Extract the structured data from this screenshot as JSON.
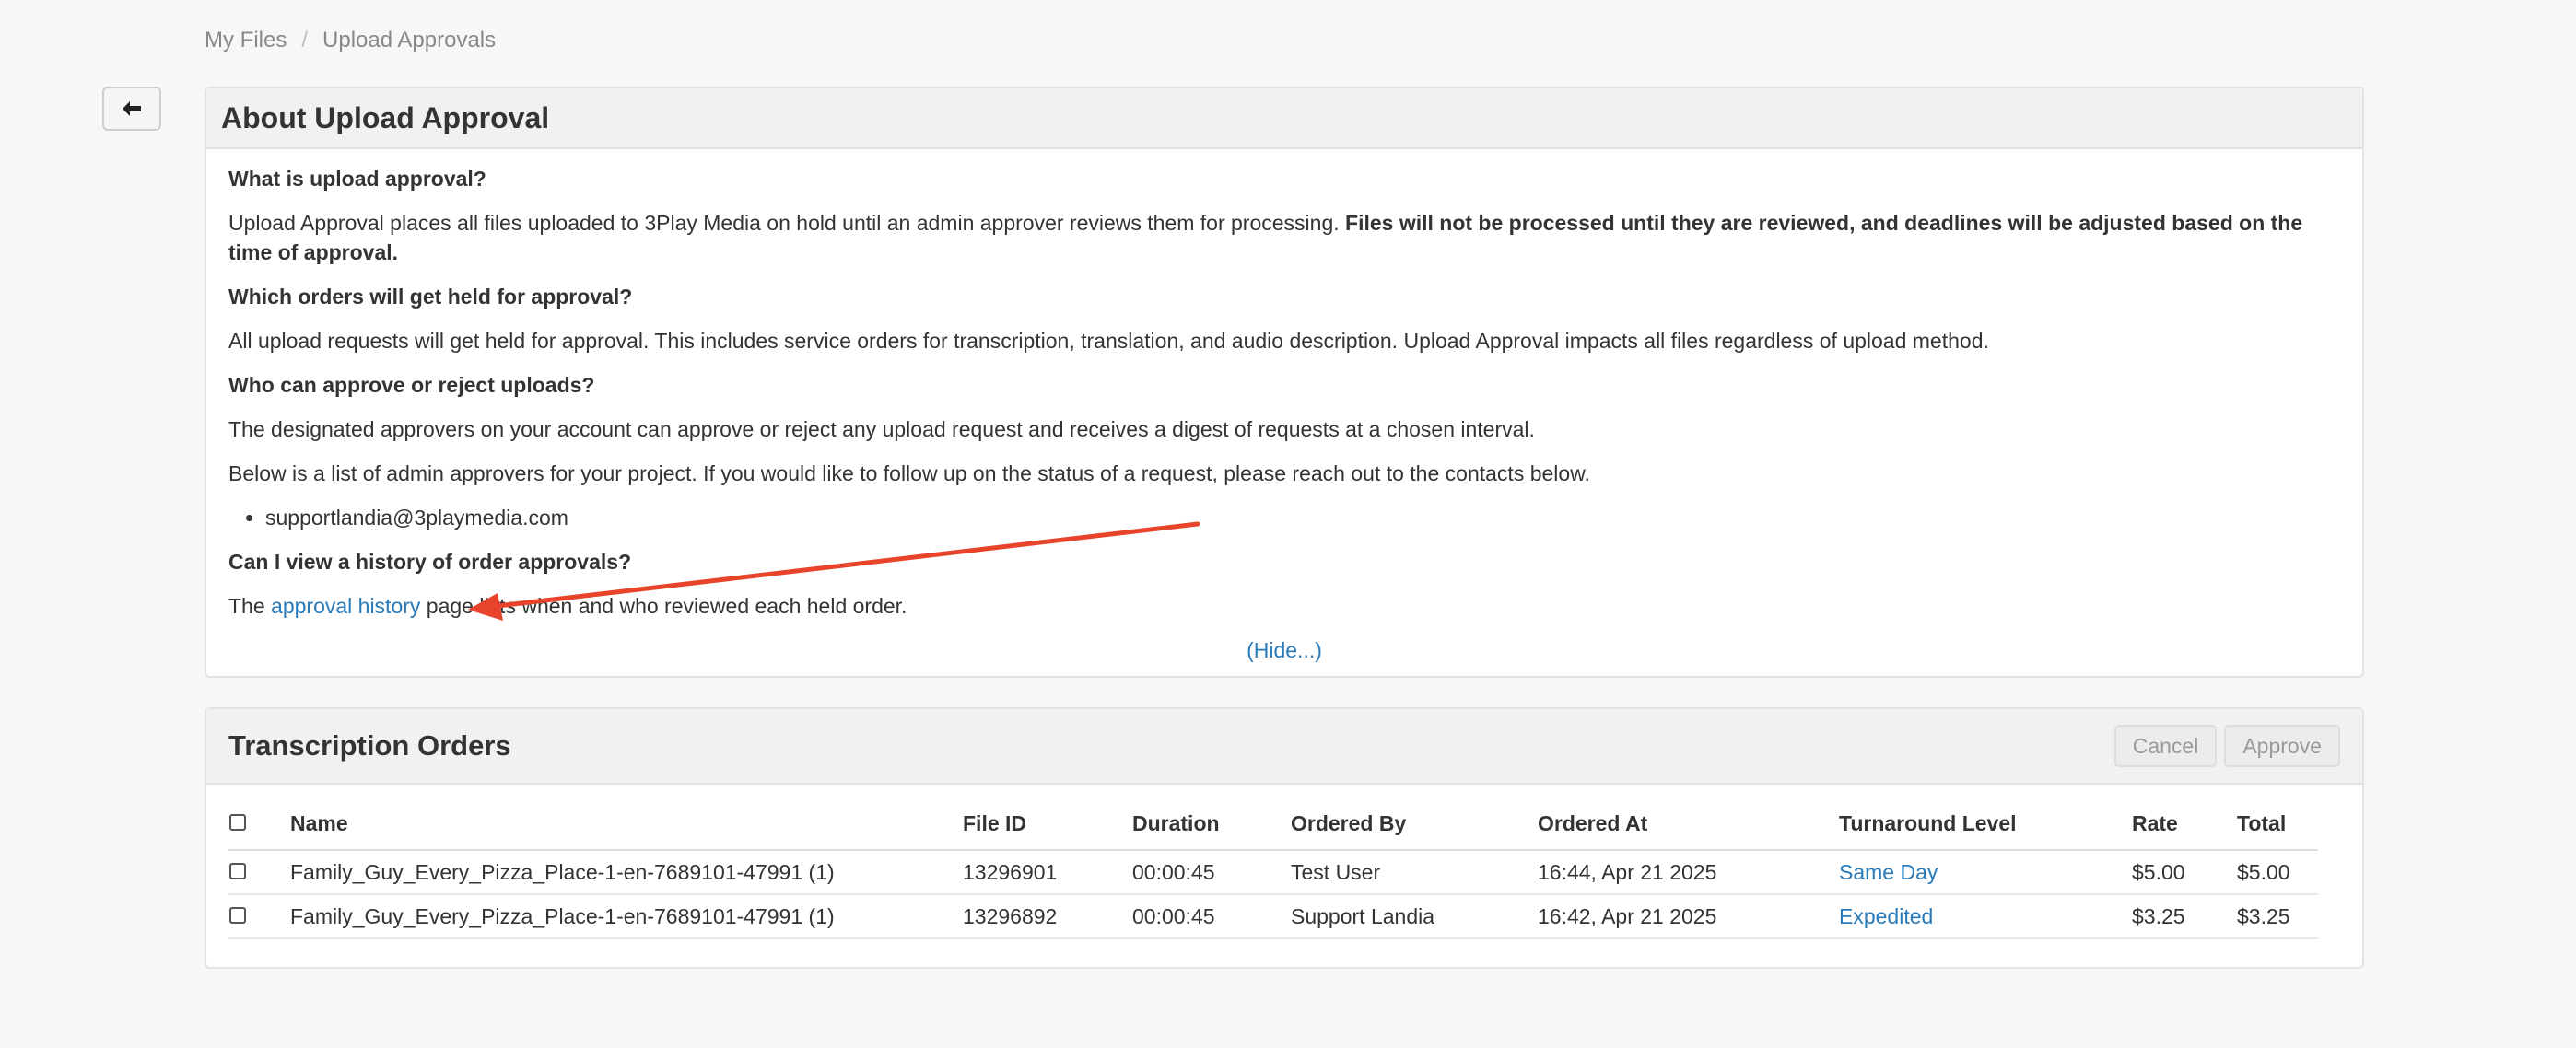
{
  "breadcrumb": {
    "item1": "My Files",
    "separator": "/",
    "item2": "Upload Approvals"
  },
  "back_button": {
    "icon": "arrow-left-icon"
  },
  "about": {
    "title": "About Upload Approval",
    "q1": "What is upload approval?",
    "a1_text": "Upload Approval places all files uploaded to 3Play Media on hold until an admin approver reviews them for processing. ",
    "a1_bold": "Files will not be processed until they are reviewed, and deadlines will be adjusted based on the time of approval.",
    "q2": "Which orders will get held for approval?",
    "a2": "All upload requests will get held for approval. This includes service orders for transcription, translation, and audio description. Upload Approval impacts all files regardless of upload method.",
    "q3": "Who can approve or reject uploads?",
    "a3": "The designated approvers on your account can approve or reject any upload request and receives a digest of requests at a chosen interval.",
    "a3b": "Below is a list of admin approvers for your project. If you would like to follow up on the status of a request, please reach out to the contacts below.",
    "contacts": [
      "supportlandia@3playmedia.com"
    ],
    "q4": "Can I view a history of order approvals?",
    "a4_prefix": "The ",
    "a4_link": "approval history",
    "a4_suffix": " page lists when and who reviewed each held order.",
    "hide_link": "(Hide...)"
  },
  "orders": {
    "title": "Transcription Orders",
    "cancel_label": "Cancel",
    "approve_label": "Approve",
    "columns": [
      "Name",
      "File ID",
      "Duration",
      "Ordered By",
      "Ordered At",
      "Turnaround Level",
      "Rate",
      "Total"
    ],
    "rows": [
      {
        "name": "Family_Guy_Every_Pizza_Place-1-en-7689101-47991 (1)",
        "file_id": "13296901",
        "duration": "00:00:45",
        "ordered_by": "Test User",
        "ordered_at": "16:44, Apr 21 2025",
        "turnaround": "Same Day",
        "rate": "$5.00",
        "total": "$5.00"
      },
      {
        "name": "Family_Guy_Every_Pizza_Place-1-en-7689101-47991 (1)",
        "file_id": "13296892",
        "duration": "00:00:45",
        "ordered_by": "Support Landia",
        "ordered_at": "16:42, Apr 21 2025",
        "turnaround": "Expedited",
        "rate": "$3.25",
        "total": "$3.25"
      }
    ]
  },
  "colors": {
    "link": "#2a7ab8",
    "annotation_arrow": "#e8432b"
  }
}
